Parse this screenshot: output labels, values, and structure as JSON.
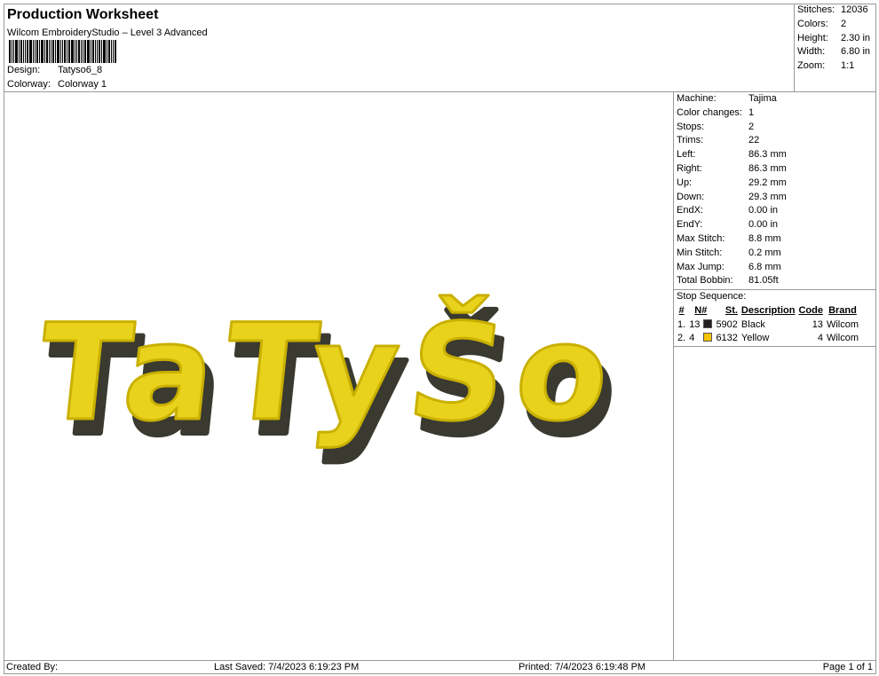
{
  "header": {
    "title": "Production Worksheet",
    "subtitle": "Wilcom EmbroideryStudio – Level 3 Advanced",
    "design_label": "Design:",
    "design_value": "Tatyso6_8",
    "colorway_label": "Colorway:",
    "colorway_value": "Colorway 1"
  },
  "stats": [
    {
      "k": "Stitches:",
      "v": "12036"
    },
    {
      "k": "Colors:",
      "v": "2"
    },
    {
      "k": "Height:",
      "v": "2.30 in"
    },
    {
      "k": "Width:",
      "v": "6.80 in"
    },
    {
      "k": "Zoom:",
      "v": "1:1"
    }
  ],
  "machine": [
    {
      "k": "Machine:",
      "v": "Tajima"
    },
    {
      "k": "Color changes:",
      "v": "1"
    },
    {
      "k": "Stops:",
      "v": "2"
    },
    {
      "k": "Trims:",
      "v": "22"
    },
    {
      "k": "Left:",
      "v": "86.3 mm"
    },
    {
      "k": "Right:",
      "v": "86.3 mm"
    },
    {
      "k": "Up:",
      "v": "29.2 mm"
    },
    {
      "k": "Down:",
      "v": "29.3 mm"
    },
    {
      "k": "EndX:",
      "v": "0.00 in"
    },
    {
      "k": "EndY:",
      "v": "0.00 in"
    },
    {
      "k": "Max Stitch:",
      "v": "8.8 mm"
    },
    {
      "k": "Min Stitch:",
      "v": "0.2 mm"
    },
    {
      "k": "Max Jump:",
      "v": "6.8 mm"
    },
    {
      "k": "Total Bobbin:",
      "v": "81.05ft"
    }
  ],
  "stop_sequence": {
    "label": "Stop Sequence:",
    "columns": [
      "#",
      "N#",
      "St.",
      "Description",
      "Code",
      "Brand"
    ],
    "rows": [
      {
        "idx": "1.",
        "n": "13",
        "color": "#231f20",
        "st": "5902",
        "desc": "Black",
        "code": "13",
        "brand": "Wilcom"
      },
      {
        "idx": "2.",
        "n": "4",
        "color": "#f5c400",
        "st": "6132",
        "desc": "Yellow",
        "code": "4",
        "brand": "Wilcom"
      }
    ]
  },
  "design": {
    "text": "TaTyŠo",
    "fill": "#e8d21c",
    "shadow": "#3a3a30"
  },
  "footer": {
    "created": "Created By:",
    "saved": "Last Saved: 7/4/2023 6:19:23 PM",
    "printed": "Printed: 7/4/2023 6:19:48 PM",
    "page": "Page 1 of 1"
  }
}
